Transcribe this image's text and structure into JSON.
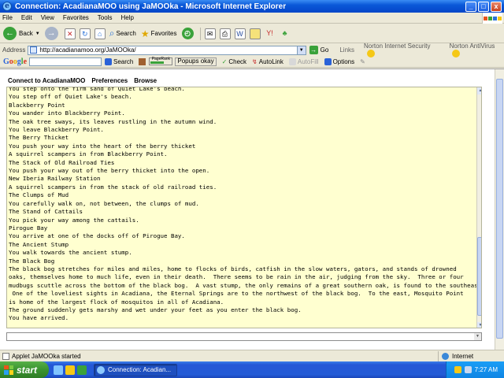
{
  "window": {
    "title": "Connection: AcadianaMOO using JaMOOka - Microsoft Internet Explorer",
    "minimize": "_",
    "maximize": "□",
    "close": "x"
  },
  "menu": [
    "File",
    "Edit",
    "View",
    "Favorites",
    "Tools",
    "Help"
  ],
  "toolbar": {
    "back": "Back",
    "search": "Search",
    "favorites": "Favorites"
  },
  "address": {
    "label": "Address",
    "url": "http://acadianamoo.org/JaMOOka/",
    "go": "Go",
    "links": "Links",
    "norton_security": "Norton Internet Security",
    "norton_antivirus": "Norton AntiVirus"
  },
  "google_bar": {
    "logo": "Google",
    "search": "Search",
    "pagerank": "PageRank",
    "popups": "Popups okay",
    "check": "Check",
    "autolink": "AutoLink",
    "autofill": "AutoFill",
    "options": "Options"
  },
  "applet_menu": [
    "Connect to AcadianaMOO",
    "Preferences",
    "Browse"
  ],
  "terminal_lines": [
    "You step onto the firm sand of Quiet Lake's beach.",
    "You step off of Quiet Lake's beach.",
    "Blackberry Point",
    "You wander into Blackberry Point.",
    "The oak tree sways, its leaves rustling in the autumn wind.",
    "You leave Blackberry Point.",
    "The Berry Thicket",
    "You push your way into the heart of the berry thicket",
    "A squirrel scampers in from Blackberry Point.",
    "The Stack of Old Railroad Ties",
    "You push your way out of the berry thicket into the open.",
    "New Iberia Railway Station",
    "A squirrel scampers in from the stack of old railroad ties.",
    "The Clumps of Mud",
    "You carefully walk on, not between, the clumps of mud.",
    "The Stand of Cattails",
    "You pick your way among the cattails.",
    "Pirogue Bay",
    "You arrive at one of the docks off of Pirogue Bay.",
    "The Ancient Stump",
    "You walk towards the ancient stump.",
    "The Black Bog",
    "The black bog stretches for miles and miles, home to flocks of birds, catfish in the slow waters, gators, and stands of drowned",
    "oaks, themselves home to much life, even in their death.  There seems to be rain in the air, judging from the sky.  Three or four",
    "mudbugs scuttle across the bottom of the black bog.  A vast stump, the only remains of a great southern oak, is found to the southeast.",
    " One of the loveliest sights in Acadiana, the Eternal Springs are to the northwest of the black bog.  To the east, Mosquito Point",
    "is home of the largest flock of mosquitos in all of Acadiana.",
    "The ground suddenly gets marshy and wet under your feet as you enter the black bog.",
    "You have arrived."
  ],
  "status": {
    "text": "Applet JaMOOka started",
    "zone": "Internet"
  },
  "taskbar": {
    "start": "start",
    "task": "Connection: Acadian...",
    "clock": "7:27 AM"
  },
  "colors": {
    "terminal_bg": "#ffffd0",
    "title_blue": "#0a58d8",
    "start_green": "#3a9330"
  }
}
